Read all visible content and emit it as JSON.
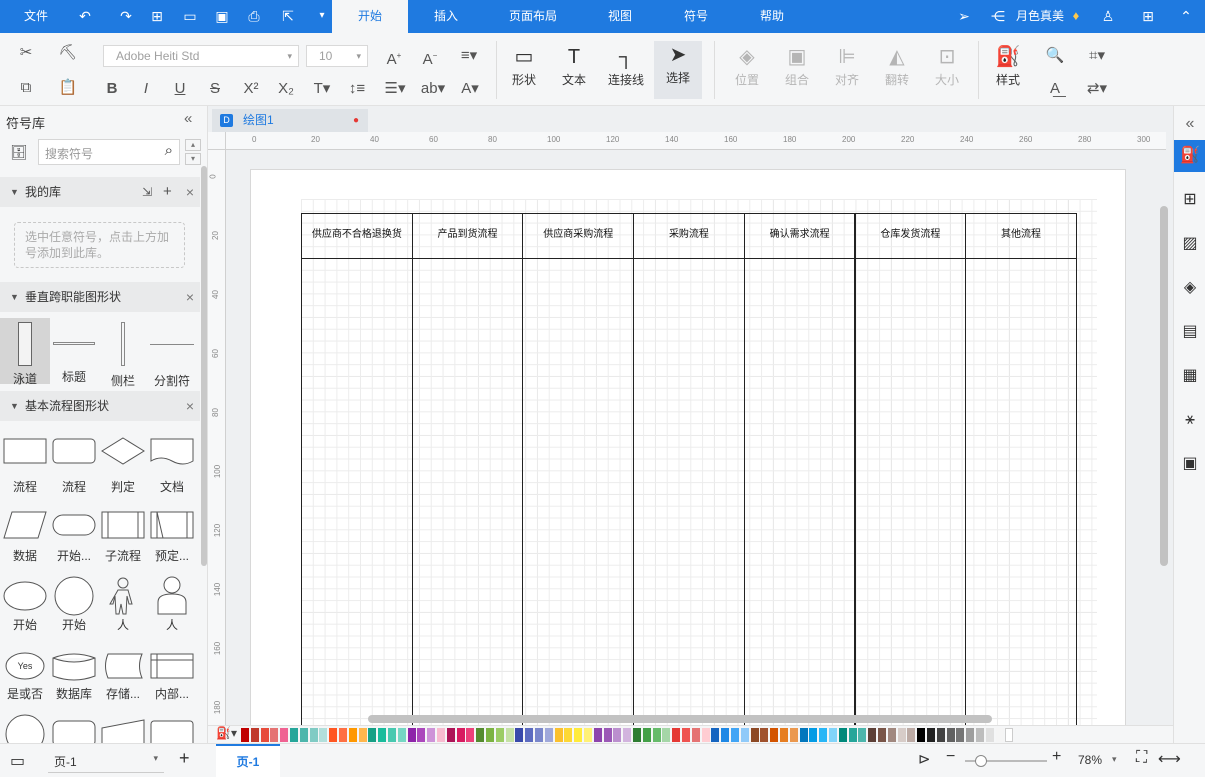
{
  "menu": {
    "file": "文件",
    "tabs": [
      {
        "label": "开始",
        "active": true
      },
      {
        "label": "插入"
      },
      {
        "label": "页面布局"
      },
      {
        "label": "视图"
      },
      {
        "label": "符号"
      },
      {
        "label": "帮助"
      }
    ],
    "user": "月色真美"
  },
  "ribbon": {
    "font_name": "Adobe Heiti Std",
    "font_size": "10",
    "tools": {
      "shape": "形状",
      "text": "文本",
      "connector": "连接线",
      "select": "选择"
    },
    "arrange": {
      "position": "位置",
      "group": "组合",
      "align": "对齐",
      "flip": "翻转",
      "size": "大小"
    },
    "style": "样式"
  },
  "library": {
    "title": "符号库",
    "search_placeholder": "搜索符号",
    "my_library": "我的库",
    "my_library_hint": "选中任意符号，点击上方加号添加到此库。",
    "vertical_section": "垂直跨职能图形状",
    "vertical_shapes": [
      "泳道",
      "标题",
      "侧栏",
      "分割符"
    ],
    "basic_section": "基本流程图形状",
    "basic_shapes": [
      "流程",
      "流程",
      "判定",
      "文档",
      "数据",
      "开始...",
      "子流程",
      "预定...",
      "开始",
      "开始",
      "人",
      "人",
      "是或否",
      "数据库",
      "存储...",
      "内部..."
    ],
    "yes_label": "Yes"
  },
  "document": {
    "tab_name": "绘图1"
  },
  "ruler": {
    "h": [
      "0",
      "20",
      "40",
      "60",
      "80",
      "100",
      "120",
      "140",
      "160",
      "180",
      "200",
      "220",
      "240",
      "260",
      "280",
      "300"
    ],
    "v": [
      "0",
      "20",
      "40",
      "60",
      "80",
      "100",
      "120",
      "140",
      "160",
      "180"
    ]
  },
  "lanes": [
    "供应商不合格退换货",
    "产品到货流程",
    "供应商采购流程",
    "采购流程",
    "确认需求流程",
    "仓库发货流程",
    "其他流程"
  ],
  "palette": [
    "#c00000",
    "#c0392b",
    "#e74c3c",
    "#e57373",
    "#f06292",
    "#26a69a",
    "#4db6ac",
    "#80cbc4",
    "#b2dfdb",
    "#ff5722",
    "#ff7043",
    "#ff9800",
    "#ffb74d",
    "#16a085",
    "#1abc9c",
    "#48c9b0",
    "#76d7c4",
    "#8e24aa",
    "#ab47bc",
    "#ce93d8",
    "#f8bbd0",
    "#ad1457",
    "#d81b60",
    "#ec407a",
    "#558b2f",
    "#7cb342",
    "#9ccc65",
    "#c5e1a5",
    "#3949ab",
    "#5c6bc0",
    "#7986cb",
    "#9fa8da",
    "#fbc02d",
    "#fdd835",
    "#ffeb3b",
    "#fff176",
    "#8e44ad",
    "#9b59b6",
    "#bb8fce",
    "#d2b4de",
    "#2e7d32",
    "#43a047",
    "#66bb6a",
    "#a5d6a7",
    "#e53935",
    "#ef5350",
    "#e57373",
    "#ffcdd2",
    "#1565c0",
    "#1e88e5",
    "#42a5f5",
    "#90caf9",
    "#8d4925",
    "#a0522d",
    "#d35400",
    "#e67e22",
    "#eb984e",
    "#0277bd",
    "#039be5",
    "#29b6f6",
    "#81d4fa",
    "#00897b",
    "#26a69a",
    "#4db6ac",
    "#5d4037",
    "#795548",
    "#a1887f",
    "#d7ccc8",
    "#bcaaa4",
    "#000000",
    "#212121",
    "#424242",
    "#616161",
    "#757575",
    "#9e9e9e",
    "#bdbdbd",
    "#e0e0e0",
    "#f5f5f5",
    "#ffffff"
  ],
  "status": {
    "page_select": "页-1",
    "active_page": "页-1",
    "zoom": "78%"
  }
}
